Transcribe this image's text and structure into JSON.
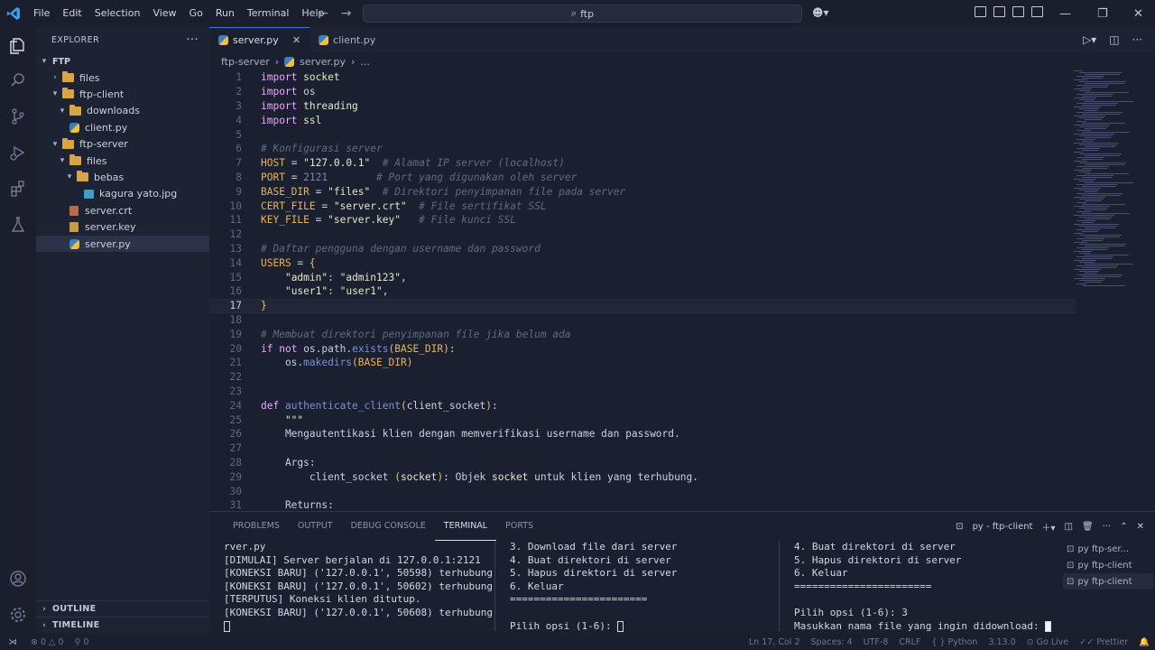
{
  "titlebar": {
    "menu": [
      "File",
      "Edit",
      "Selection",
      "View",
      "Go",
      "Run",
      "Terminal",
      "Help"
    ],
    "search": "ftp"
  },
  "explorer": {
    "header": "EXPLORER",
    "root": "FTP",
    "items": [
      {
        "label": "files",
        "kind": "folder",
        "open": false,
        "depth": 1
      },
      {
        "label": "ftp-client",
        "kind": "folder",
        "open": true,
        "depth": 1
      },
      {
        "label": "downloads",
        "kind": "folder",
        "open": true,
        "depth": 2
      },
      {
        "label": "client.py",
        "kind": "py",
        "depth": 2
      },
      {
        "label": "ftp-server",
        "kind": "folder",
        "open": true,
        "depth": 1
      },
      {
        "label": "files",
        "kind": "folder",
        "open": true,
        "depth": 2
      },
      {
        "label": "bebas",
        "kind": "folder",
        "open": true,
        "depth": 3
      },
      {
        "label": "kagura yato.jpg",
        "kind": "img",
        "depth": 4
      },
      {
        "label": "server.crt",
        "kind": "crt",
        "depth": 2
      },
      {
        "label": "server.key",
        "kind": "key",
        "depth": 2
      },
      {
        "label": "server.py",
        "kind": "py",
        "depth": 2,
        "selected": true
      }
    ],
    "outline": "OUTLINE",
    "timeline": "TIMELINE"
  },
  "tabs": [
    {
      "label": "server.py",
      "active": true
    },
    {
      "label": "client.py",
      "active": false
    }
  ],
  "breadcrumb": {
    "folder": "ftp-server",
    "file": "server.py",
    "more": "..."
  },
  "code": {
    "current_line": 17,
    "lines": [
      "import socket",
      "import os",
      "import threading",
      "import ssl",
      "",
      "# Konfigurasi server",
      "HOST = \"127.0.0.1\"  # Alamat IP server (localhost)",
      "PORT = 2121        # Port yang digunakan oleh server",
      "BASE_DIR = \"files\"  # Direktori penyimpanan file pada server",
      "CERT_FILE = \"server.crt\"  # File sertifikat SSL",
      "KEY_FILE = \"server.key\"   # File kunci SSL",
      "",
      "# Daftar pengguna dengan username dan password",
      "USERS = {",
      "    \"admin\": \"admin123\",",
      "    \"user1\": \"user1\",",
      "}",
      "",
      "# Membuat direktori penyimpanan file jika belum ada",
      "if not os.path.exists(BASE_DIR):",
      "    os.makedirs(BASE_DIR)",
      "",
      "",
      "def authenticate_client(client_socket):",
      "    \"\"\"",
      "    Mengautentikasi klien dengan memverifikasi username dan password.",
      "",
      "    Args:",
      "        client_socket (socket): Objek socket untuk klien yang terhubung.",
      "",
      "    Returns:"
    ]
  },
  "panel": {
    "tabs": [
      "PROBLEMS",
      "OUTPUT",
      "DEBUG CONSOLE",
      "TERMINAL",
      "PORTS"
    ],
    "active_tab": "TERMINAL",
    "terminal_title": "py - ftp-client",
    "terminal1": [
      "rver.py",
      "[DIMULAI] Server berjalan di 127.0.0.1:2121",
      "[KONEKSI BARU] ('127.0.0.1', 50598) terhubung.",
      "[KONEKSI BARU] ('127.0.0.1', 50602) terhubung.",
      "[TERPUTUS] Koneksi klien ditutup.",
      "[KONEKSI BARU] ('127.0.0.1', 50608) terhubung."
    ],
    "terminal2": [
      "3. Download file dari server",
      "4. Buat direktori di server",
      "5. Hapus direktori di server",
      "6. Keluar",
      "=======================",
      "",
      "Pilih opsi (1-6): "
    ],
    "terminal3": [
      "4. Buat direktori di server",
      "5. Hapus direktori di server",
      "6. Keluar",
      "=======================",
      "",
      "Pilih opsi (1-6): 3",
      "Masukkan nama file yang ingin didownload: "
    ],
    "terminal_list": [
      {
        "label": "py ftp-ser...",
        "selected": false
      },
      {
        "label": "py ftp-client",
        "selected": false
      },
      {
        "label": "py ftp-client",
        "selected": true
      }
    ]
  },
  "statusbar": {
    "errors": "0",
    "warnings": "0",
    "ports": "0",
    "position": "Ln 17, Col 2",
    "spaces": "Spaces: 4",
    "encoding": "UTF-8",
    "eol": "CRLF",
    "language": "Python",
    "version": "3.13.0",
    "golive": "Go Live",
    "prettier": "Prettier"
  }
}
